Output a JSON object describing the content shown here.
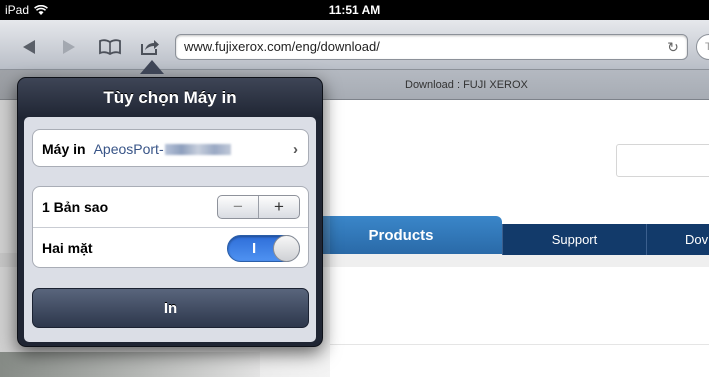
{
  "status_bar": {
    "device": "iPad",
    "time": "11:51 AM"
  },
  "toolbar": {
    "url": "www.fujixerox.com/eng/download/",
    "search_placeholder": "T"
  },
  "tab": {
    "title": "Download : FUJI XEROX"
  },
  "page": {
    "tabs": [
      "Products",
      "Support",
      "Dov"
    ]
  },
  "print_popover": {
    "title": "Tùy chọn Máy in",
    "printer_label": "Máy in",
    "printer_value": "ApeosPort-",
    "copies_label": "1 Bản sao",
    "duplex_label": "Hai mặt",
    "duplex_state": "I",
    "print_button": "In"
  },
  "colors": {
    "popover_bg": "#1f2533",
    "toggle_on": "#2e6ed8",
    "products_tab": "#3a86c9",
    "nav_tab": "#123a6a"
  }
}
